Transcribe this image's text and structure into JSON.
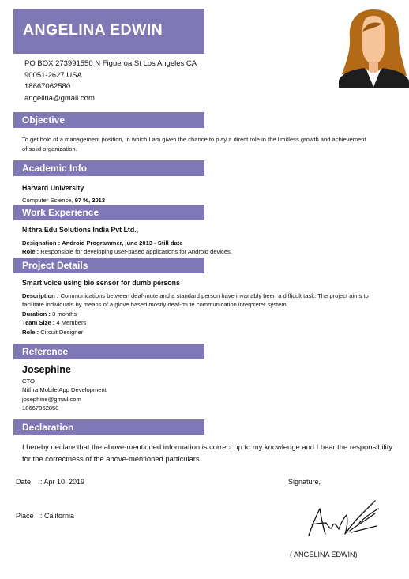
{
  "header": {
    "name": "ANGELINA EDWIN",
    "address_line1": "PO BOX 273991550 N Figueroa St Los Angeles CA",
    "address_line2": "90051-2627 USA",
    "phone": "18667062580",
    "email": "angelina@gmail.com"
  },
  "objective": {
    "title": "Objective",
    "text_line1": "To get hold of a management position, in which I am given the chance to play a direct role in the limitless growth and achievement",
    "text_line2": "of solid organization."
  },
  "academic": {
    "title": "Academic Info",
    "school": "Harvard University",
    "course": "Computer Science,",
    "score_year": "97 %, 2013"
  },
  "work": {
    "title": "Work Experience",
    "company": "Nithra Edu Solutions India Pvt Ltd.,",
    "designation_label": "Designation :",
    "designation_value": "Android Programmer, june 2013 - Still date",
    "role_label": "Role :",
    "role_value": "Responsible for developing user-based applications for Android devices."
  },
  "project": {
    "title": "Project Details",
    "name": "Smart voice using bio sensor for dumb persons",
    "description_label": "Description :",
    "description_line1": "Communications between deaf-mute and a standard person have invariably been a difficult task. The project aims to",
    "description_line2": "facilitate individuals by means of a glove based mostly deaf-mute communication interpreter system.",
    "duration_label": "Duration :",
    "duration_value": "3 months",
    "team_label": "Team Size :",
    "team_value": "4 Members",
    "role_label": "Role :",
    "role_value": "Circuit Designer"
  },
  "reference": {
    "title": "Reference",
    "name": "Josephine",
    "position": "CTO",
    "company": "Nithra Mobile App Development",
    "email": "josephine@gmail.com",
    "phone": "18667062850"
  },
  "declaration": {
    "title": "Declaration",
    "text": "I hereby declare that the above-mentioned information is correct up to my knowledge and I bear the responsibility for the correctness of the above-mentioned particulars."
  },
  "footer": {
    "date_label": "Date",
    "date_value": ": Apr 10, 2019",
    "place_label": "Place",
    "place_value": ": California",
    "signature_label": "Signature,",
    "signature_name": "( ANGELINA EDWIN)"
  },
  "colors": {
    "accent": "#7f78b4",
    "hair": "#b36a16",
    "skin": "#f6c49a",
    "jacket": "#1e1e1e"
  }
}
